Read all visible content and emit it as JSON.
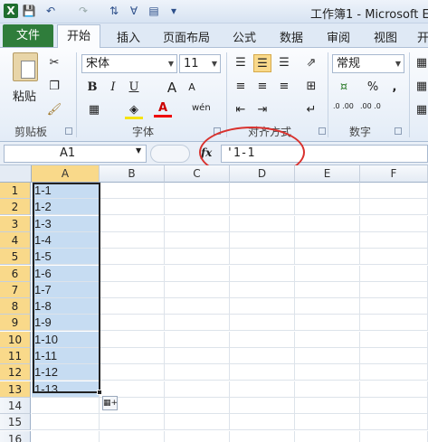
{
  "titlebar": {
    "title": "工作簿1 - Microsoft E",
    "qat_icons": [
      "excel-icon",
      "save-icon",
      "undo-icon",
      "redo-icon",
      "sort-icon",
      "filter-icon",
      "form-icon",
      "customize-qat-icon"
    ]
  },
  "tabs": [
    {
      "label": "文件"
    },
    {
      "label": "开始"
    },
    {
      "label": "插入"
    },
    {
      "label": "页面布局"
    },
    {
      "label": "公式"
    },
    {
      "label": "数据"
    },
    {
      "label": "审阅"
    },
    {
      "label": "视图"
    },
    {
      "label": "开"
    }
  ],
  "ribbon": {
    "clipboard": {
      "paste_label": "粘贴",
      "group_label": "剪贴板"
    },
    "font": {
      "name": "宋体",
      "size": "11",
      "group_label": "字体",
      "bold": "B",
      "italic": "I",
      "underline": "U",
      "grow": "A",
      "shrink": "A",
      "phonetic": "wén"
    },
    "alignment": {
      "group_label": "对齐方式"
    },
    "number": {
      "format": "常规",
      "group_label": "数字",
      "percent": "%",
      "comma": ",",
      "inc_decimal": ".0 .00",
      "dec_decimal": ".00 .0"
    }
  },
  "formula_bar": {
    "name_box": "A1",
    "fx": "fx",
    "formula": "'1-1"
  },
  "sheet": {
    "columns": [
      "A",
      "B",
      "C",
      "D",
      "E",
      "F"
    ],
    "rows": [
      "1",
      "2",
      "3",
      "4",
      "5",
      "6",
      "7",
      "8",
      "9",
      "10",
      "11",
      "12",
      "13",
      "14",
      "15",
      "16"
    ],
    "col_a_values": [
      "1-1",
      "1-2",
      "1-3",
      "1-4",
      "1-5",
      "1-6",
      "1-7",
      "1-8",
      "1-9",
      "1-10",
      "1-11",
      "1-12",
      "1-13"
    ]
  },
  "colors": {
    "accent_green": "#2f7d3b",
    "selection": "#c6dcf2",
    "header_highlight": "#f9d98a",
    "annotation_red": "#d9322e"
  }
}
